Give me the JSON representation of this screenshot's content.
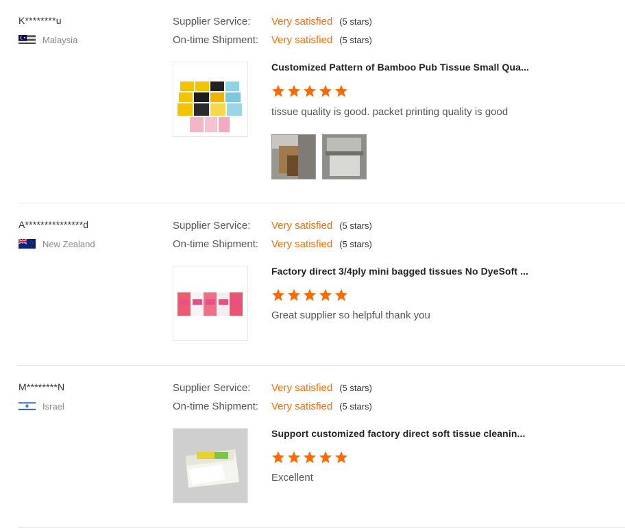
{
  "reviews": [
    {
      "reviewer": "K********u",
      "country": "Malaysia",
      "flag_icon": "malaysia-flag-icon",
      "supplier_service": {
        "label": "Supplier Service:",
        "value": "Very satisfied",
        "stars_note": "(5 stars)"
      },
      "shipment": {
        "label": "On-time Shipment:",
        "value": "Very satisfied",
        "stars_note": "(5 stars)"
      },
      "product_title": "Customized Pattern of Bamboo Pub Tissue Small Qua...",
      "rating": 5,
      "comment": "tissue quality is good. packet printing quality is good",
      "photos": 2
    },
    {
      "reviewer": "A***************d",
      "country": "New Zealand",
      "flag_icon": "new-zealand-flag-icon",
      "supplier_service": {
        "label": "Supplier Service:",
        "value": "Very satisfied",
        "stars_note": "(5 stars)"
      },
      "shipment": {
        "label": "On-time Shipment:",
        "value": "Very satisfied",
        "stars_note": "(5 stars)"
      },
      "product_title": "Factory direct 3/4ply mini bagged tissues No DyeSoft ...",
      "rating": 5,
      "comment": "Great supplier so helpful thank you",
      "photos": 0
    },
    {
      "reviewer": "M********N",
      "country": "Israel",
      "flag_icon": "israel-flag-icon",
      "supplier_service": {
        "label": "Supplier Service:",
        "value": "Very satisfied",
        "stars_note": "(5 stars)"
      },
      "shipment": {
        "label": "On-time Shipment:",
        "value": "Very satisfied",
        "stars_note": "(5 stars)"
      },
      "product_title": "Support customized factory direct soft tissue cleanin...",
      "rating": 5,
      "comment": "Excellent",
      "photos": 0
    }
  ],
  "colors": {
    "accent": "#ff6a00",
    "star": "#ff6a00",
    "divider": "#e3e3e3"
  }
}
